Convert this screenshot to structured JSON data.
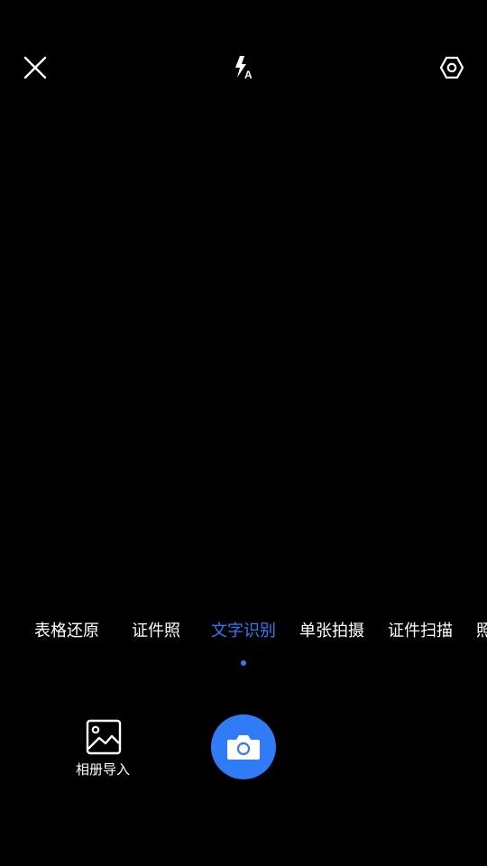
{
  "top_bar": {
    "close_icon": "close-icon",
    "flash_icon": "flash-auto-icon",
    "settings_icon": "settings-hex-icon"
  },
  "modes": {
    "items": [
      {
        "label": "表格还原",
        "active": false
      },
      {
        "label": "证件照",
        "active": false
      },
      {
        "label": "文字识别",
        "active": true
      },
      {
        "label": "单张拍摄",
        "active": false
      },
      {
        "label": "证件扫描",
        "active": false
      },
      {
        "label": "照",
        "active": false
      }
    ]
  },
  "bottom": {
    "album_label": "相册导入",
    "album_icon": "image-icon",
    "shutter_icon": "camera-icon"
  },
  "colors": {
    "background": "#000000",
    "accent": "#2f7cf6",
    "text": "#ffffff"
  }
}
